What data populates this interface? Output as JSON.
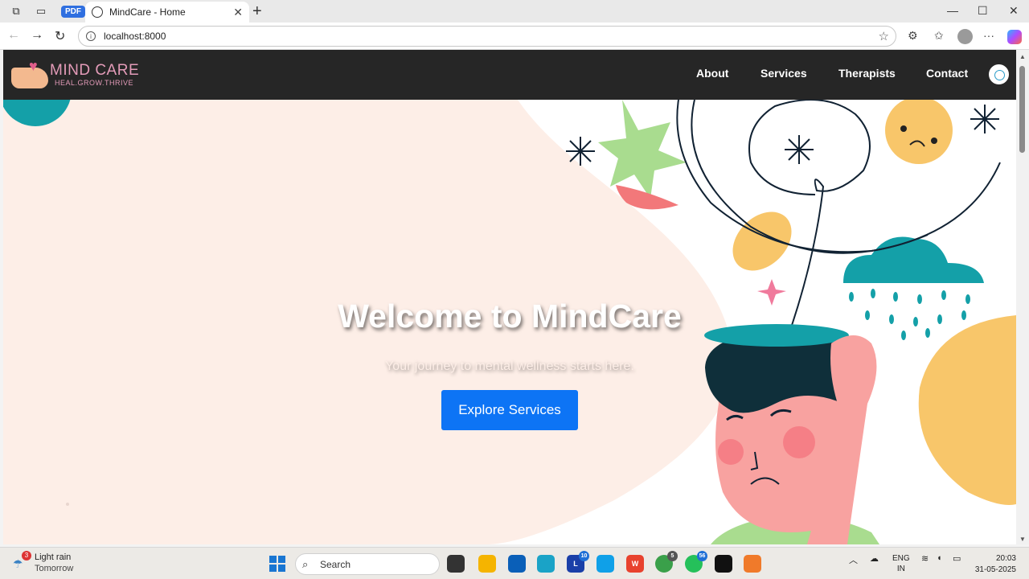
{
  "browser": {
    "tab_title": "MindCare - Home",
    "pdf_label": "PDF",
    "url": "localhost:8000"
  },
  "site": {
    "logo_name": "MIND CARE",
    "logo_tagline": "HEAL.GROW.THRIVE",
    "nav": [
      "About",
      "Services",
      "Therapists",
      "Contact"
    ],
    "hero_title": "Welcome to MindCare",
    "hero_subtitle": "Your journey to mental wellness starts here.",
    "cta_label": "Explore Services"
  },
  "taskbar": {
    "weather_title": "Light rain",
    "weather_sub": "Tomorrow",
    "weather_badge": "3",
    "search_placeholder": "Search",
    "lang_line1": "ENG",
    "lang_line2": "IN",
    "time": "20:03",
    "date": "31-05-2025",
    "badges": {
      "l_app": "10",
      "chrome": "5",
      "whatsapp": "56"
    }
  },
  "colors": {
    "navbar": "#262626",
    "hero_bg": "#fdeee7",
    "cta": "#0d74f5",
    "logo_pink": "#e39bb8"
  }
}
